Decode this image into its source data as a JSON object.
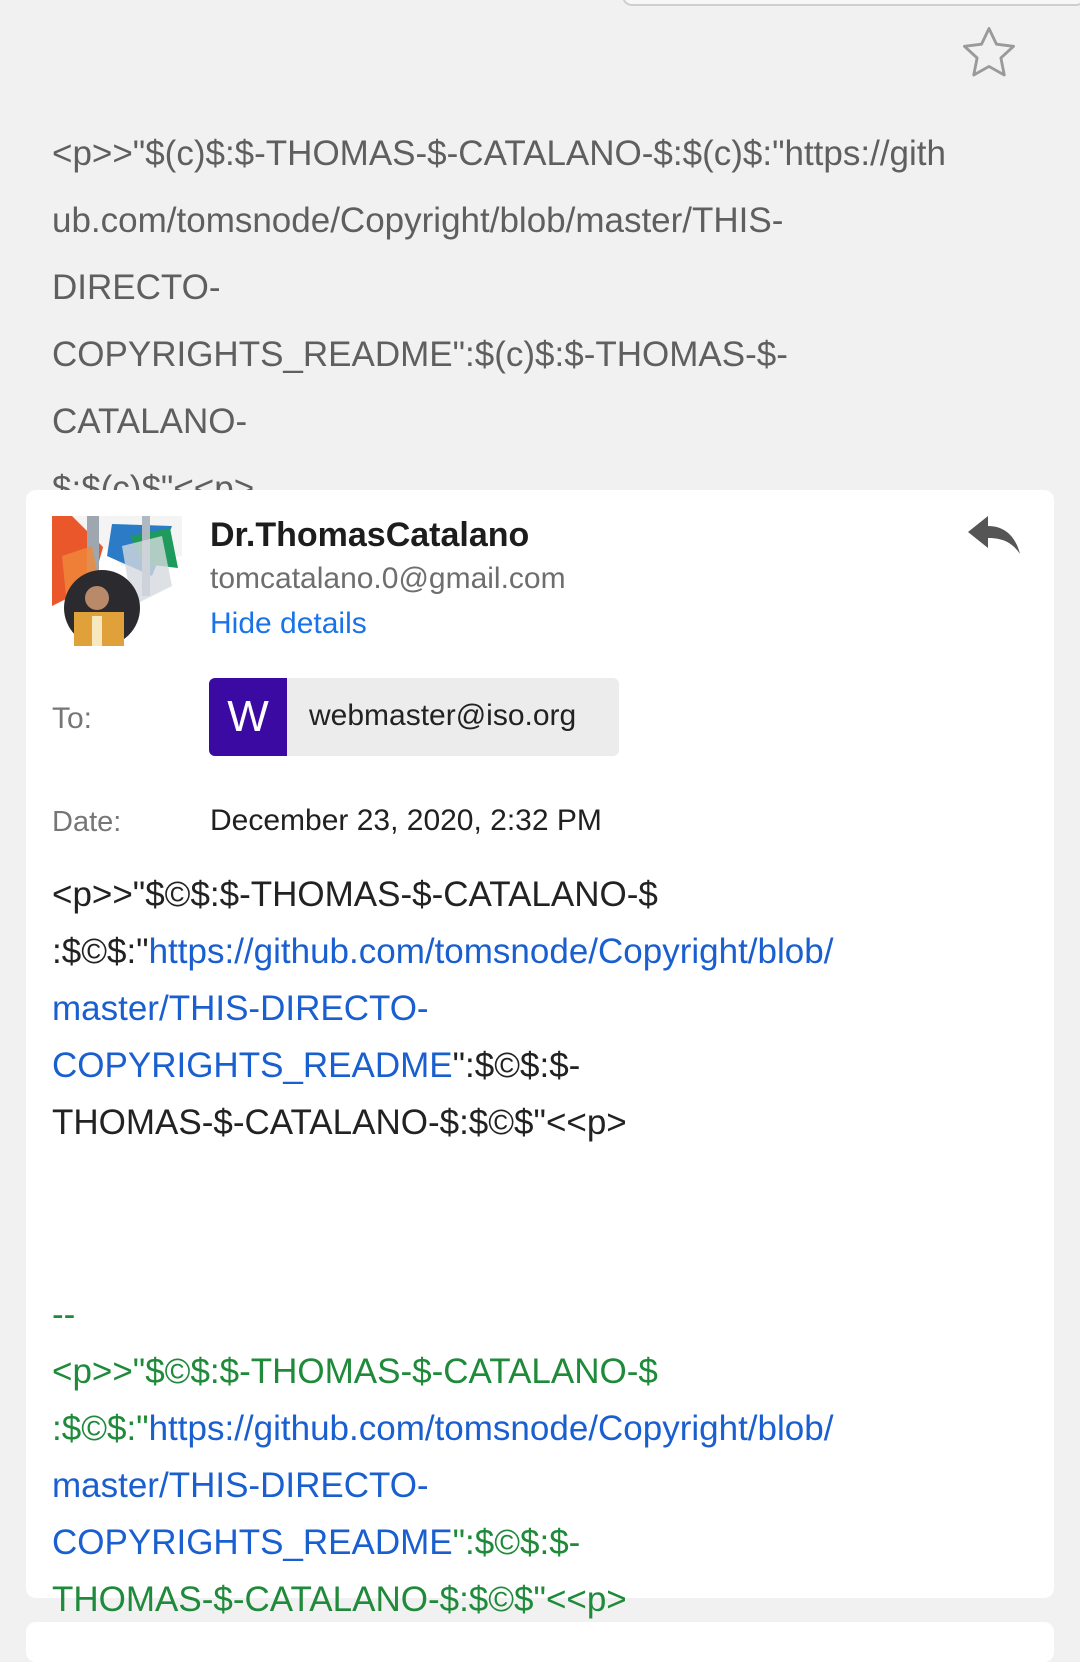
{
  "preview": {
    "line1": "<p>>\"$(c)$:$-THOMAS-$-CATALANO-$:$(c)$:\"https://gith",
    "line2": "ub.com/tomsnode/Copyright/blob/master/THIS-",
    "line3": "DIRECTO-",
    "line4": "COPYRIGHTS_README\":$(c)$:$-THOMAS-$-CATALANO-",
    "line5": "$:$(c)$\"<<p>"
  },
  "sender": {
    "name": "Dr.ThomasCatalano",
    "email": "tomcatalano.0@gmail.com",
    "hide_details": "Hide details"
  },
  "to": {
    "label": "To:",
    "initial": "W",
    "email": "webmaster@iso.org",
    "chip_color": "#3b0aa3"
  },
  "date": {
    "label": "Date:",
    "value": "December 23, 2020, 2:32 PM"
  },
  "body": {
    "line1": "<p>>\"$©$:$-THOMAS-$-CATALANO-$",
    "line2_prefix": ":$©$:\"",
    "link_part1": "https://github.com/tomsnode/Copyright/blob/",
    "link_part2": "master/THIS-DIRECTO-COPYRIGHTS_README",
    "line3_suffix": "\":$©$:$-",
    "line4": "THOMAS-$-CATALANO-$:$©$\"<<p>"
  },
  "signature": {
    "dashes": "--",
    "line1": "<p>>\"$©$:$-THOMAS-$-CATALANO-$",
    "line2_prefix": ":$©$:\"",
    "link_part1": "https://github.com/tomsnode/Copyright/blob/",
    "link_part2": "master/THIS-DIRECTO-COPYRIGHTS_README",
    "line3_suffix": "\":$©$:$-",
    "line4": "THOMAS-$-CATALANO-$:$©$\"<<p>",
    "color": "#1e8a3a"
  },
  "colors": {
    "link": "#1a5fd0",
    "accent": "#1a73e8",
    "background": "#f1f1f1"
  },
  "icons": {
    "star": "star-outline-icon",
    "reply": "reply-icon"
  }
}
